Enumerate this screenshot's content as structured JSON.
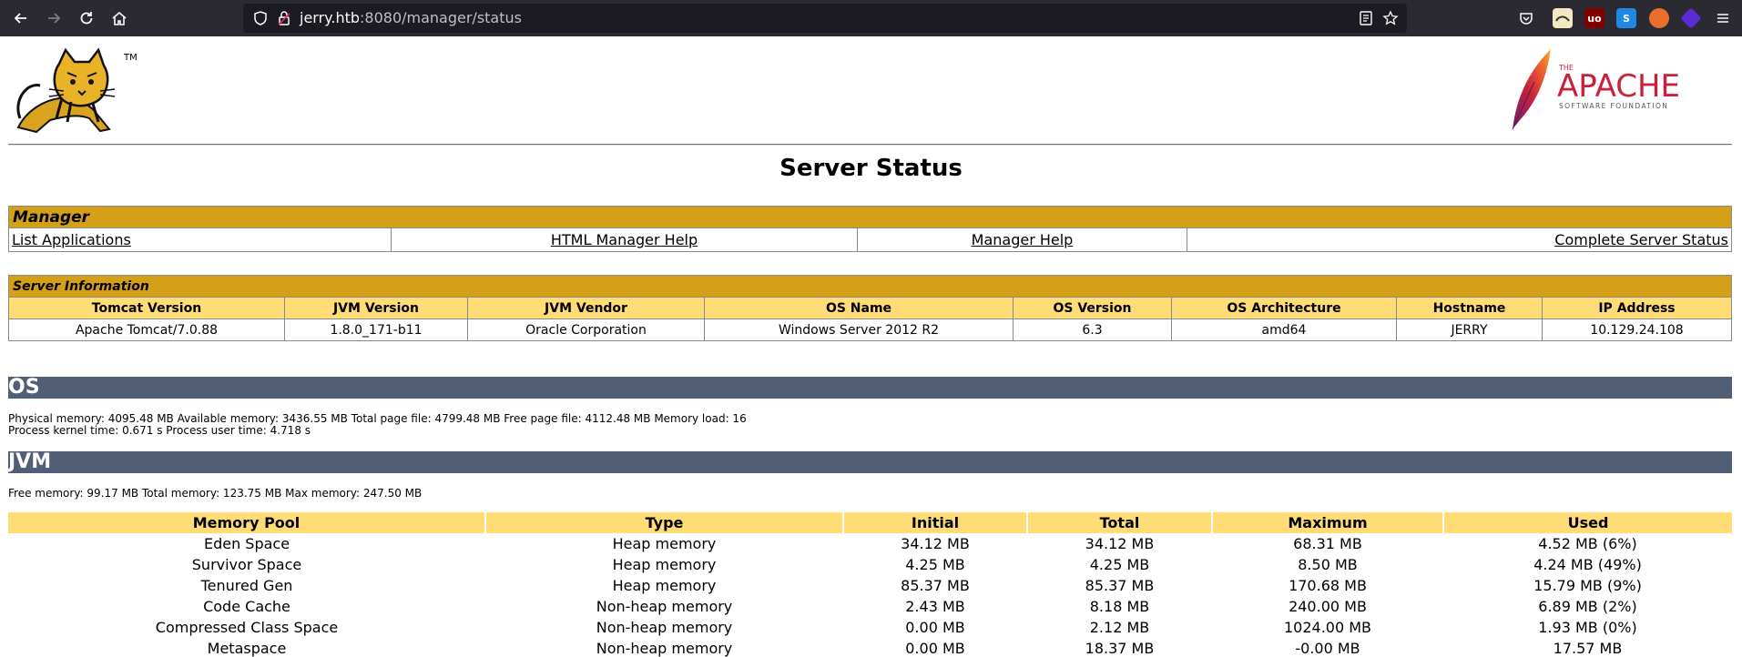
{
  "browser": {
    "url_host": "jerry.htb",
    "url_path": ":8080/manager/status"
  },
  "page": {
    "title": "Server Status",
    "tomcat_tm": "TM",
    "apache_small": "THE",
    "apache_name": "APACHE",
    "apache_sub": "SOFTWARE FOUNDATION"
  },
  "manager": {
    "heading": "Manager",
    "links": [
      "List Applications",
      "HTML Manager Help",
      "Manager Help",
      "Complete Server Status"
    ]
  },
  "server_info": {
    "heading": "Server Information",
    "headers": [
      "Tomcat Version",
      "JVM Version",
      "JVM Vendor",
      "OS Name",
      "OS Version",
      "OS Architecture",
      "Hostname",
      "IP Address"
    ],
    "values": [
      "Apache Tomcat/7.0.88",
      "1.8.0_171-b11",
      "Oracle Corporation",
      "Windows Server 2012 R2",
      "6.3",
      "amd64",
      "JERRY",
      "10.129.24.108"
    ]
  },
  "os": {
    "heading": "OS",
    "line1": "Physical memory: 4095.48 MB Available memory: 3436.55 MB Total page file: 4799.48 MB Free page file: 4112.48 MB Memory load: 16",
    "line2": "Process kernel time: 0.671 s Process user time: 4.718 s"
  },
  "jvm": {
    "heading": "JVM",
    "line1": "Free memory: 99.17 MB Total memory: 123.75 MB Max memory: 247.50 MB"
  },
  "memory_pools": {
    "headers": [
      "Memory Pool",
      "Type",
      "Initial",
      "Total",
      "Maximum",
      "Used"
    ],
    "rows": [
      [
        "Eden Space",
        "Heap memory",
        "34.12 MB",
        "34.12 MB",
        "68.31 MB",
        "4.52 MB (6%)"
      ],
      [
        "Survivor Space",
        "Heap memory",
        "4.25 MB",
        "4.25 MB",
        "8.50 MB",
        "4.24 MB (49%)"
      ],
      [
        "Tenured Gen",
        "Heap memory",
        "85.37 MB",
        "85.37 MB",
        "170.68 MB",
        "15.79 MB (9%)"
      ],
      [
        "Code Cache",
        "Non-heap memory",
        "2.43 MB",
        "8.18 MB",
        "240.00 MB",
        "6.89 MB (2%)"
      ],
      [
        "Compressed Class Space",
        "Non-heap memory",
        "0.00 MB",
        "2.12 MB",
        "1024.00 MB",
        "1.93 MB (0%)"
      ],
      [
        "Metaspace",
        "Non-heap memory",
        "0.00 MB",
        "18.37 MB",
        "-0.00 MB",
        "17.57 MB"
      ]
    ]
  },
  "colors": {
    "section_head": "#d4a017",
    "column_head": "#ffdc75",
    "band": "#525d76",
    "toolbar": "#2b2a33"
  }
}
